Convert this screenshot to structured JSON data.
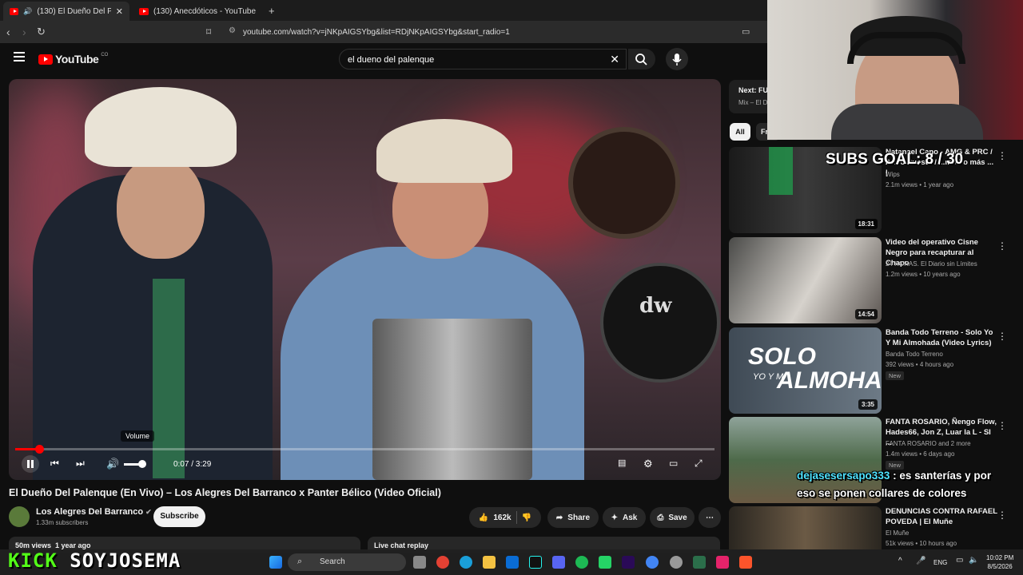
{
  "browser": {
    "tabs": [
      {
        "label": "(130) El Dueño Del Palenque"
      },
      {
        "label": "(130) Anecdóticos - YouTube"
      }
    ],
    "new_tab": "+",
    "url": "youtube.com/watch?v=jNKpAIGSYbg&list=RDjNKpAIGSYbg&start_radio=1"
  },
  "youtube": {
    "logo_text": "YouTube",
    "logo_region": "CO",
    "search_value": "el dueno del palenque"
  },
  "player": {
    "time": "0:07 / 3:29",
    "volume_tooltip": "Volume",
    "progress_fraction": 0.034
  },
  "video": {
    "title": "El Dueño Del Palenque (En Vivo) – Los Alegres Del Barranco x Panter Bélico (Video Oficial)",
    "channel": "Los Alegres Del Barranco",
    "subscribers": "1.33m subscribers",
    "subscribe_label": "Subscribe",
    "likes": "162k",
    "share_label": "Share",
    "ask_label": "Ask",
    "save_label": "Save",
    "views_line": "50m views  1 year ago",
    "live_chat": "Live chat replay"
  },
  "sidebar": {
    "next_label": "Next: FU",
    "next_sub": "Mix – El D",
    "chips": [
      "All",
      "Fr"
    ],
    "recommendations": [
      {
        "title": "Natanael Cano - AMG & PRC / Ando Puesto / ...mo Lo más ... |",
        "channel": "Wips",
        "meta": "2.1m views • 1 year ago",
        "duration": "18:31",
        "new": ""
      },
      {
        "title": "Video del operativo Cisne Negro para recapturar al Chapo",
        "channel": "24 HORAS. El Diario sin Límites",
        "meta": "1.2m views • 10 years ago",
        "duration": "14:54",
        "new": ""
      },
      {
        "title": "Banda Todo Terreno - Solo Yo Y Mi Almohada (Video Lyrics)",
        "channel": "Banda Todo Terreno",
        "meta": "392 views • 4 hours ago",
        "duration": "3:35",
        "new": "New",
        "thumb_text_1": "SOLO",
        "thumb_text_2": "YO Y MI",
        "thumb_text_3": "ALMOHADA"
      },
      {
        "title": "FANTA ROSARIO, Ñengo Flow, Hades66, Jon Z,  Luar la L - SI ...",
        "channel": "FANTA ROSARIO  and 2 more",
        "meta": "1.4m views • 6 days ago",
        "duration": "",
        "new": "New"
      },
      {
        "title": "DENUNCIAS CONTRA RAFAEL POVEDA | El Muñe",
        "channel": "El Muñe",
        "meta": "51k views • 10 hours ago",
        "duration": "",
        "new": ""
      }
    ]
  },
  "overlay": {
    "subs_goal": "SUBS GOAL: 8 / 30",
    "chat_user": "dejasesersapo333",
    "chat_message": " : es santerías y por eso se ponen collares de colores",
    "kick_brand": "KICK",
    "kick_name": "SOYJOSEMA"
  },
  "taskbar": {
    "search_label": "Search",
    "lang": "ENG",
    "time": "10:02 PM",
    "date": "8/5/2026"
  }
}
